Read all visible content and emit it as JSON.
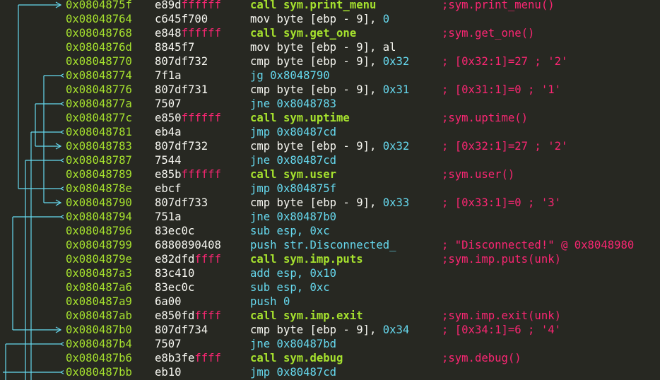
{
  "colors": {
    "background": "#272822",
    "address": "#a6e22e",
    "bytes": "#f8f8f2",
    "bytes_ff": "#f92672",
    "call": "#a6e22e",
    "mnemonic": "#66d9ef",
    "comment": "#f92672",
    "arrow": "#66d9ef"
  },
  "rows": [
    {
      "addr": "0x0804875f",
      "bytes": "e89d",
      "bytes_ff": "ffffff",
      "kind": "call",
      "mn": "call sym.print_menu",
      "cmt": ";sym.print_menu()"
    },
    {
      "addr": "0x08048764",
      "bytes": "c645f700",
      "bytes_ff": "",
      "kind": "mov",
      "mn": "mov byte [ebp - 9], 0",
      "cmt": ""
    },
    {
      "addr": "0x08048768",
      "bytes": "e848",
      "bytes_ff": "ffffff",
      "kind": "call",
      "mn": "call sym.get_one",
      "cmt": ";sym.get_one()"
    },
    {
      "addr": "0x0804876d",
      "bytes": "8845f7",
      "bytes_ff": "",
      "kind": "mov",
      "mn": "mov byte [ebp - 9], al",
      "cmt": ""
    },
    {
      "addr": "0x08048770",
      "bytes": "807df732",
      "bytes_ff": "",
      "kind": "cmp",
      "mn": "cmp byte [ebp - 9], 0x32",
      "cmt": "; [0x32:1]=27 ; '2'"
    },
    {
      "addr": "0x08048774",
      "bytes": "7f1a",
      "bytes_ff": "",
      "kind": "jcc",
      "mn": "jg 0x8048790",
      "cmt": ""
    },
    {
      "addr": "0x08048776",
      "bytes": "807df731",
      "bytes_ff": "",
      "kind": "cmp",
      "mn": "cmp byte [ebp - 9], 0x31",
      "cmt": "; [0x31:1]=0 ; '1'"
    },
    {
      "addr": "0x0804877a",
      "bytes": "7507",
      "bytes_ff": "",
      "kind": "jcc",
      "mn": "jne 0x8048783",
      "cmt": ""
    },
    {
      "addr": "0x0804877c",
      "bytes": "e850",
      "bytes_ff": "ffffff",
      "kind": "call",
      "mn": "call sym.uptime",
      "cmt": ";sym.uptime()"
    },
    {
      "addr": "0x08048781",
      "bytes": "eb4a",
      "bytes_ff": "",
      "kind": "jmp",
      "mn": "jmp 0x80487cd",
      "cmt": ""
    },
    {
      "addr": "0x08048783",
      "bytes": "807df732",
      "bytes_ff": "",
      "kind": "cmp",
      "mn": "cmp byte [ebp - 9], 0x32",
      "cmt": "; [0x32:1]=27 ; '2'"
    },
    {
      "addr": "0x08048787",
      "bytes": "7544",
      "bytes_ff": "",
      "kind": "jcc",
      "mn": "jne 0x80487cd",
      "cmt": ""
    },
    {
      "addr": "0x08048789",
      "bytes": "e85b",
      "bytes_ff": "ffffff",
      "kind": "call",
      "mn": "call sym.user",
      "cmt": ";sym.user()"
    },
    {
      "addr": "0x0804878e",
      "bytes": "ebcf",
      "bytes_ff": "",
      "kind": "jmp",
      "mn": "jmp 0x804875f",
      "cmt": ""
    },
    {
      "addr": "0x08048790",
      "bytes": "807df733",
      "bytes_ff": "",
      "kind": "cmp",
      "mn": "cmp byte [ebp - 9], 0x33",
      "cmt": "; [0x33:1]=0 ; '3'"
    },
    {
      "addr": "0x08048794",
      "bytes": "751a",
      "bytes_ff": "",
      "kind": "jcc",
      "mn": "jne 0x80487b0",
      "cmt": ""
    },
    {
      "addr": "0x08048796",
      "bytes": "83ec0c",
      "bytes_ff": "",
      "kind": "sub",
      "mn": "sub esp, 0xc",
      "cmt": ""
    },
    {
      "addr": "0x08048799",
      "bytes": "6880890408",
      "bytes_ff": "",
      "kind": "push",
      "mn": "push str.Disconnected_",
      "cmt": "; \"Disconnected!\" @ 0x8048980"
    },
    {
      "addr": "0x0804879e",
      "bytes": "e82dfd",
      "bytes_ff": "ffff",
      "kind": "call",
      "mn": "call sym.imp.puts",
      "cmt": ";sym.imp.puts(unk)"
    },
    {
      "addr": "0x080487a3",
      "bytes": "83c410",
      "bytes_ff": "",
      "kind": "add",
      "mn": "add esp, 0x10",
      "cmt": ""
    },
    {
      "addr": "0x080487a6",
      "bytes": "83ec0c",
      "bytes_ff": "",
      "kind": "sub",
      "mn": "sub esp, 0xc",
      "cmt": ""
    },
    {
      "addr": "0x080487a9",
      "bytes": "6a00",
      "bytes_ff": "",
      "kind": "push",
      "mn": "push 0",
      "cmt": ""
    },
    {
      "addr": "0x080487ab",
      "bytes": "e850fd",
      "bytes_ff": "ffff",
      "kind": "call",
      "mn": "call sym.imp.exit",
      "cmt": ";sym.imp.exit(unk)"
    },
    {
      "addr": "0x080487b0",
      "bytes": "807df734",
      "bytes_ff": "",
      "kind": "cmp",
      "mn": "cmp byte [ebp - 9], 0x34",
      "cmt": "; [0x34:1]=6 ; '4'"
    },
    {
      "addr": "0x080487b4",
      "bytes": "7507",
      "bytes_ff": "",
      "kind": "jcc",
      "mn": "jne 0x80487bd",
      "cmt": ""
    },
    {
      "addr": "0x080487b6",
      "bytes": "e8b3fe",
      "bytes_ff": "ffff",
      "kind": "call",
      "mn": "call sym.debug",
      "cmt": ";sym.debug()"
    },
    {
      "addr": "0x080487bb",
      "bytes": "eb10",
      "bytes_ff": "",
      "kind": "jmp",
      "mn": "jmp 0x80487cd",
      "cmt": ""
    }
  ]
}
